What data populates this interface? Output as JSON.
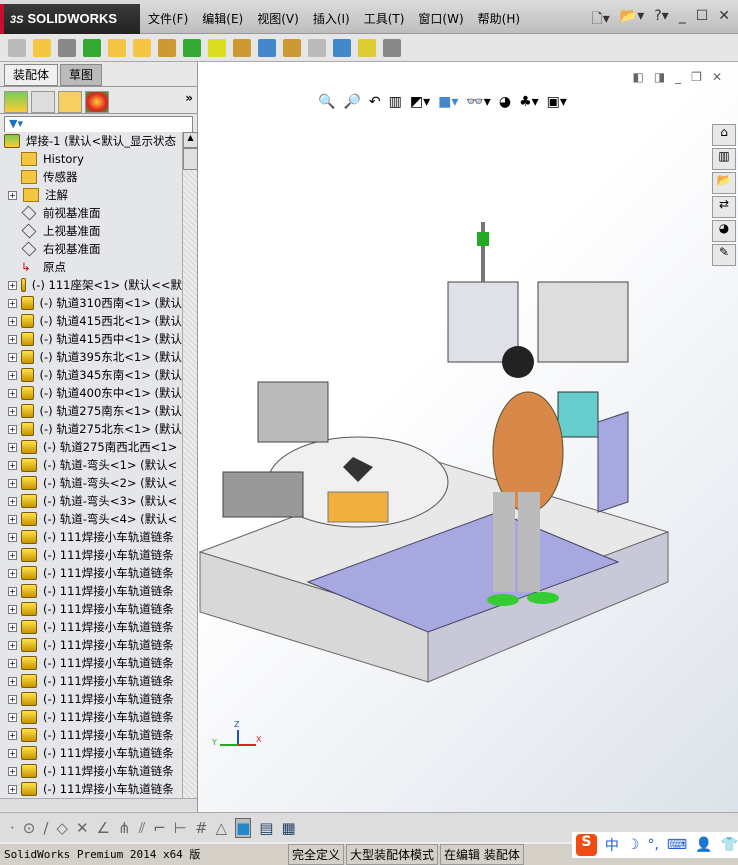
{
  "app": {
    "logo": "SOLIDWORKS",
    "menu": [
      "文件(F)",
      "编辑(E)",
      "视图(V)",
      "插入(I)",
      "工具(T)",
      "窗口(W)",
      "帮助(H)"
    ]
  },
  "panel": {
    "tabs": [
      "装配体",
      "草图"
    ],
    "root": "焊接-1  (默认<默认_显示状态",
    "fixed": [
      "History",
      "传感器",
      "注解",
      "前视基准面",
      "上视基准面",
      "右视基准面",
      "原点"
    ],
    "components": [
      "(-) 111座架<1> (默认<<默",
      "(-) 轨道310西南<1> (默认",
      "(-) 轨道415西北<1> (默认",
      "(-) 轨道415西中<1> (默认",
      "(-) 轨道395东北<1> (默认",
      "(-) 轨道345东南<1> (默认",
      "(-) 轨道400东中<1> (默认",
      "(-) 轨道275南东<1> (默认",
      "(-) 轨道275北东<1> (默认",
      "(-) 轨道275南西北西<1>",
      "(-) 轨道-弯头<1> (默认<",
      "(-) 轨道-弯头<2> (默认<",
      "(-) 轨道-弯头<3> (默认<",
      "(-) 轨道-弯头<4> (默认<",
      "(-) 111焊接小车轨道链条",
      "(-) 111焊接小车轨道链条",
      "(-) 111焊接小车轨道链条",
      "(-) 111焊接小车轨道链条",
      "(-) 111焊接小车轨道链条",
      "(-) 111焊接小车轨道链条",
      "(-) 111焊接小车轨道链条",
      "(-) 111焊接小车轨道链条",
      "(-) 111焊接小车轨道链条",
      "(-) 111焊接小车轨道链条",
      "(-) 111焊接小车轨道链条",
      "(-) 111焊接小车轨道链条",
      "(-) 111焊接小车轨道链条",
      "(-) 111焊接小车轨道链条",
      "(-) 111焊接小车轨道链条"
    ]
  },
  "triad": {
    "x": "X",
    "y": "Y",
    "z": "Z"
  },
  "status": {
    "product": "SolidWorks Premium 2014 x64 版",
    "state": "完全定义",
    "mode": "大型装配体模式",
    "editing": "在编辑 装配体"
  },
  "ime": {
    "logo": "S",
    "lang": "中"
  }
}
